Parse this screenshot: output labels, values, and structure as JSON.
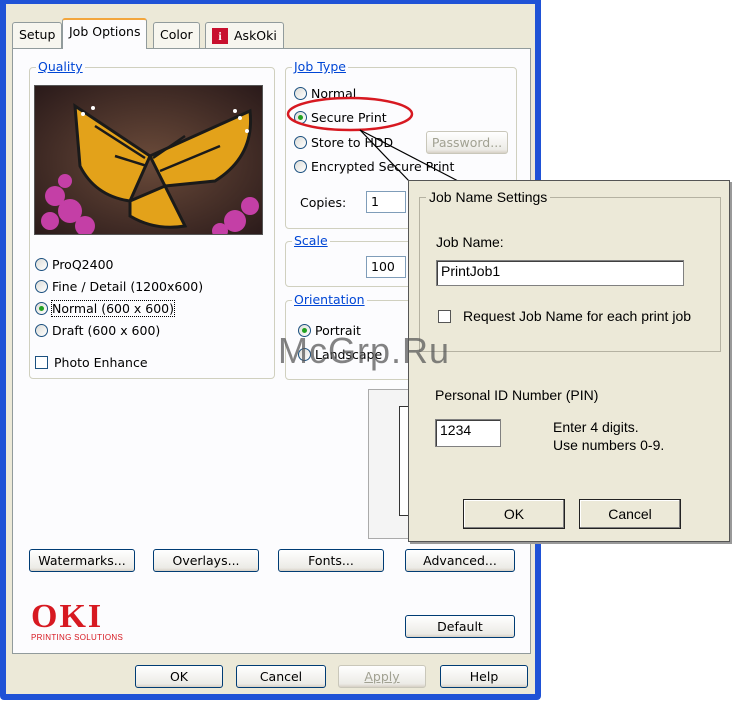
{
  "tabs": [
    {
      "label": "Setup"
    },
    {
      "label": "Job Options"
    },
    {
      "label": "Color"
    },
    {
      "label": "AskOki",
      "icon": "info-icon"
    }
  ],
  "quality": {
    "title": "Quality",
    "options": [
      {
        "label": "ProQ2400",
        "selected": false
      },
      {
        "label": "Fine / Detail (1200x600)",
        "selected": false
      },
      {
        "label": "Normal (600 x 600)",
        "selected": true
      },
      {
        "label": "Draft (600 x 600)",
        "selected": false
      }
    ],
    "photo_enhance": "Photo Enhance"
  },
  "job_type": {
    "title": "Job Type",
    "options": [
      {
        "label": "Normal",
        "selected": false
      },
      {
        "label": "Secure Print",
        "selected": true
      },
      {
        "label": "Store to HDD",
        "selected": false
      },
      {
        "label": "Encrypted Secure Print",
        "selected": false
      }
    ],
    "password_button": "Password...",
    "copies_label": "Copies:",
    "copies_value": "1"
  },
  "scale": {
    "title": "Scale",
    "value": "100"
  },
  "orientation": {
    "title": "Orientation",
    "portrait": "Portrait",
    "landscape": "Landscape"
  },
  "buttons": {
    "watermarks": "Watermarks...",
    "overlays": "Overlays...",
    "fonts": "Fonts...",
    "advanced": "Advanced...",
    "default": "Default",
    "ok": "OK",
    "cancel": "Cancel",
    "apply": "Apply",
    "help": "Help"
  },
  "logo": {
    "brand": "OKI",
    "tagline": "PRINTING SOLUTIONS",
    "color": "#d71921"
  },
  "popup": {
    "group_title": "Job Name Settings",
    "job_name_label": "Job Name:",
    "job_name_value": "PrintJob1",
    "request_label": "Request Job Name for each print job",
    "pin_label": "Personal ID Number (PIN)",
    "pin_value": "1234",
    "pin_hint_1": "Enter 4 digits.",
    "pin_hint_2": "Use numbers 0-9.",
    "ok": "OK",
    "cancel": "Cancel"
  },
  "watermark_text": "McGrp.Ru",
  "colors": {
    "accent_blue": "#0046d5",
    "highlight_red": "#d71921",
    "radio_green": "#21a121"
  }
}
